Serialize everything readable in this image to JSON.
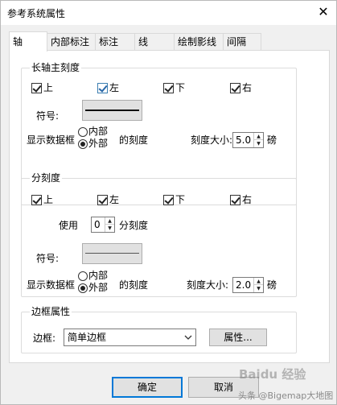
{
  "window": {
    "title": "参考系统属性",
    "close_glyph": "✕"
  },
  "tabs": [
    "轴",
    "内部标注",
    "标注",
    "线",
    "绘制影线",
    "间隔"
  ],
  "major_ticks": {
    "title": "长轴主刻度",
    "checks": [
      {
        "label": "上",
        "checked": true
      },
      {
        "label": "左",
        "checked": true
      },
      {
        "label": "下",
        "checked": true
      },
      {
        "label": "右",
        "checked": true
      }
    ],
    "symbol_label": "符号:",
    "frame_label": "显示数据框",
    "radio_inner": "内部",
    "radio_outer": "外部",
    "ticks_suffix": "的刻度",
    "size_label": "刻度大小:",
    "size_value": "5.0",
    "unit": "磅"
  },
  "minor_ticks": {
    "title": "分刻度",
    "checks": [
      {
        "label": "上",
        "checked": true
      },
      {
        "label": "左",
        "checked": true
      },
      {
        "label": "下",
        "checked": true
      },
      {
        "label": "右",
        "checked": true
      }
    ],
    "use_label": "使用",
    "use_value": "0",
    "use_suffix": "分刻度",
    "symbol_label": "符号:",
    "frame_label": "显示数据框",
    "radio_inner": "内部",
    "radio_outer": "外部",
    "ticks_suffix": "的刻度",
    "size_label": "刻度大小:",
    "size_value": "2.0",
    "unit": "磅"
  },
  "border": {
    "title": "边框属性",
    "label": "边框:",
    "value": "简单边框",
    "properties_button": "属性..."
  },
  "footer": {
    "ok": "确定",
    "cancel": "取消",
    "watermark_small": "头条 @Bigemap大地图",
    "watermark_large": "Baidu 经验"
  },
  "colors": {
    "accent_check": "#2a68a8",
    "default_button_border": "#0078d7"
  }
}
